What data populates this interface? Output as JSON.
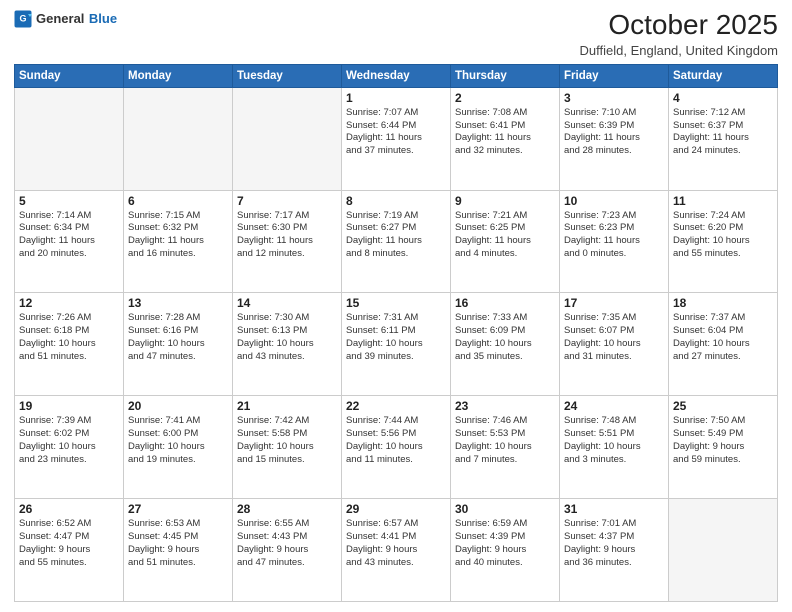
{
  "header": {
    "logo_general": "General",
    "logo_blue": "Blue",
    "month": "October 2025",
    "location": "Duffield, England, United Kingdom"
  },
  "weekdays": [
    "Sunday",
    "Monday",
    "Tuesday",
    "Wednesday",
    "Thursday",
    "Friday",
    "Saturday"
  ],
  "weeks": [
    [
      {
        "day": "",
        "lines": []
      },
      {
        "day": "",
        "lines": []
      },
      {
        "day": "",
        "lines": []
      },
      {
        "day": "1",
        "lines": [
          "Sunrise: 7:07 AM",
          "Sunset: 6:44 PM",
          "Daylight: 11 hours",
          "and 37 minutes."
        ]
      },
      {
        "day": "2",
        "lines": [
          "Sunrise: 7:08 AM",
          "Sunset: 6:41 PM",
          "Daylight: 11 hours",
          "and 32 minutes."
        ]
      },
      {
        "day": "3",
        "lines": [
          "Sunrise: 7:10 AM",
          "Sunset: 6:39 PM",
          "Daylight: 11 hours",
          "and 28 minutes."
        ]
      },
      {
        "day": "4",
        "lines": [
          "Sunrise: 7:12 AM",
          "Sunset: 6:37 PM",
          "Daylight: 11 hours",
          "and 24 minutes."
        ]
      }
    ],
    [
      {
        "day": "5",
        "lines": [
          "Sunrise: 7:14 AM",
          "Sunset: 6:34 PM",
          "Daylight: 11 hours",
          "and 20 minutes."
        ]
      },
      {
        "day": "6",
        "lines": [
          "Sunrise: 7:15 AM",
          "Sunset: 6:32 PM",
          "Daylight: 11 hours",
          "and 16 minutes."
        ]
      },
      {
        "day": "7",
        "lines": [
          "Sunrise: 7:17 AM",
          "Sunset: 6:30 PM",
          "Daylight: 11 hours",
          "and 12 minutes."
        ]
      },
      {
        "day": "8",
        "lines": [
          "Sunrise: 7:19 AM",
          "Sunset: 6:27 PM",
          "Daylight: 11 hours",
          "and 8 minutes."
        ]
      },
      {
        "day": "9",
        "lines": [
          "Sunrise: 7:21 AM",
          "Sunset: 6:25 PM",
          "Daylight: 11 hours",
          "and 4 minutes."
        ]
      },
      {
        "day": "10",
        "lines": [
          "Sunrise: 7:23 AM",
          "Sunset: 6:23 PM",
          "Daylight: 11 hours",
          "and 0 minutes."
        ]
      },
      {
        "day": "11",
        "lines": [
          "Sunrise: 7:24 AM",
          "Sunset: 6:20 PM",
          "Daylight: 10 hours",
          "and 55 minutes."
        ]
      }
    ],
    [
      {
        "day": "12",
        "lines": [
          "Sunrise: 7:26 AM",
          "Sunset: 6:18 PM",
          "Daylight: 10 hours",
          "and 51 minutes."
        ]
      },
      {
        "day": "13",
        "lines": [
          "Sunrise: 7:28 AM",
          "Sunset: 6:16 PM",
          "Daylight: 10 hours",
          "and 47 minutes."
        ]
      },
      {
        "day": "14",
        "lines": [
          "Sunrise: 7:30 AM",
          "Sunset: 6:13 PM",
          "Daylight: 10 hours",
          "and 43 minutes."
        ]
      },
      {
        "day": "15",
        "lines": [
          "Sunrise: 7:31 AM",
          "Sunset: 6:11 PM",
          "Daylight: 10 hours",
          "and 39 minutes."
        ]
      },
      {
        "day": "16",
        "lines": [
          "Sunrise: 7:33 AM",
          "Sunset: 6:09 PM",
          "Daylight: 10 hours",
          "and 35 minutes."
        ]
      },
      {
        "day": "17",
        "lines": [
          "Sunrise: 7:35 AM",
          "Sunset: 6:07 PM",
          "Daylight: 10 hours",
          "and 31 minutes."
        ]
      },
      {
        "day": "18",
        "lines": [
          "Sunrise: 7:37 AM",
          "Sunset: 6:04 PM",
          "Daylight: 10 hours",
          "and 27 minutes."
        ]
      }
    ],
    [
      {
        "day": "19",
        "lines": [
          "Sunrise: 7:39 AM",
          "Sunset: 6:02 PM",
          "Daylight: 10 hours",
          "and 23 minutes."
        ]
      },
      {
        "day": "20",
        "lines": [
          "Sunrise: 7:41 AM",
          "Sunset: 6:00 PM",
          "Daylight: 10 hours",
          "and 19 minutes."
        ]
      },
      {
        "day": "21",
        "lines": [
          "Sunrise: 7:42 AM",
          "Sunset: 5:58 PM",
          "Daylight: 10 hours",
          "and 15 minutes."
        ]
      },
      {
        "day": "22",
        "lines": [
          "Sunrise: 7:44 AM",
          "Sunset: 5:56 PM",
          "Daylight: 10 hours",
          "and 11 minutes."
        ]
      },
      {
        "day": "23",
        "lines": [
          "Sunrise: 7:46 AM",
          "Sunset: 5:53 PM",
          "Daylight: 10 hours",
          "and 7 minutes."
        ]
      },
      {
        "day": "24",
        "lines": [
          "Sunrise: 7:48 AM",
          "Sunset: 5:51 PM",
          "Daylight: 10 hours",
          "and 3 minutes."
        ]
      },
      {
        "day": "25",
        "lines": [
          "Sunrise: 7:50 AM",
          "Sunset: 5:49 PM",
          "Daylight: 9 hours",
          "and 59 minutes."
        ]
      }
    ],
    [
      {
        "day": "26",
        "lines": [
          "Sunrise: 6:52 AM",
          "Sunset: 4:47 PM",
          "Daylight: 9 hours",
          "and 55 minutes."
        ]
      },
      {
        "day": "27",
        "lines": [
          "Sunrise: 6:53 AM",
          "Sunset: 4:45 PM",
          "Daylight: 9 hours",
          "and 51 minutes."
        ]
      },
      {
        "day": "28",
        "lines": [
          "Sunrise: 6:55 AM",
          "Sunset: 4:43 PM",
          "Daylight: 9 hours",
          "and 47 minutes."
        ]
      },
      {
        "day": "29",
        "lines": [
          "Sunrise: 6:57 AM",
          "Sunset: 4:41 PM",
          "Daylight: 9 hours",
          "and 43 minutes."
        ]
      },
      {
        "day": "30",
        "lines": [
          "Sunrise: 6:59 AM",
          "Sunset: 4:39 PM",
          "Daylight: 9 hours",
          "and 40 minutes."
        ]
      },
      {
        "day": "31",
        "lines": [
          "Sunrise: 7:01 AM",
          "Sunset: 4:37 PM",
          "Daylight: 9 hours",
          "and 36 minutes."
        ]
      },
      {
        "day": "",
        "lines": []
      }
    ]
  ]
}
